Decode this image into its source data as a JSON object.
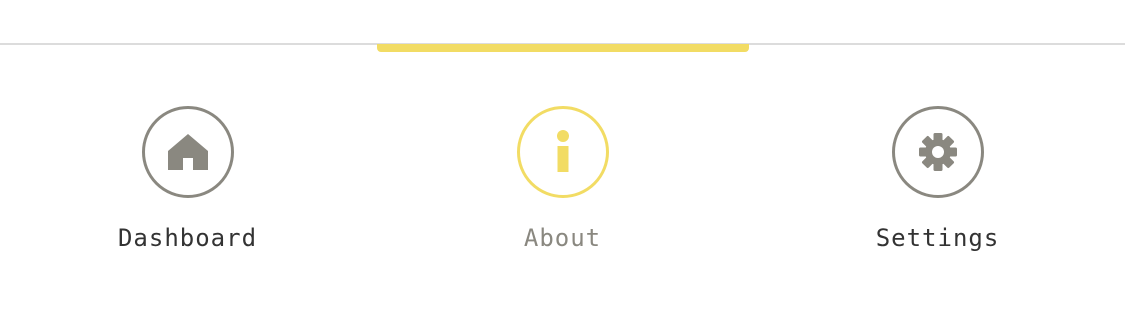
{
  "tabbar": {
    "active_index": 1,
    "colors": {
      "accent": "#f2dc64",
      "icon": "#8a8880",
      "label": "#333333",
      "active_label": "#8a8880",
      "divider": "#dcdcdc"
    },
    "tabs": [
      {
        "label": "Dashboard",
        "icon": "home-icon"
      },
      {
        "label": "About",
        "icon": "info-icon"
      },
      {
        "label": "Settings",
        "icon": "gear-icon"
      }
    ]
  }
}
